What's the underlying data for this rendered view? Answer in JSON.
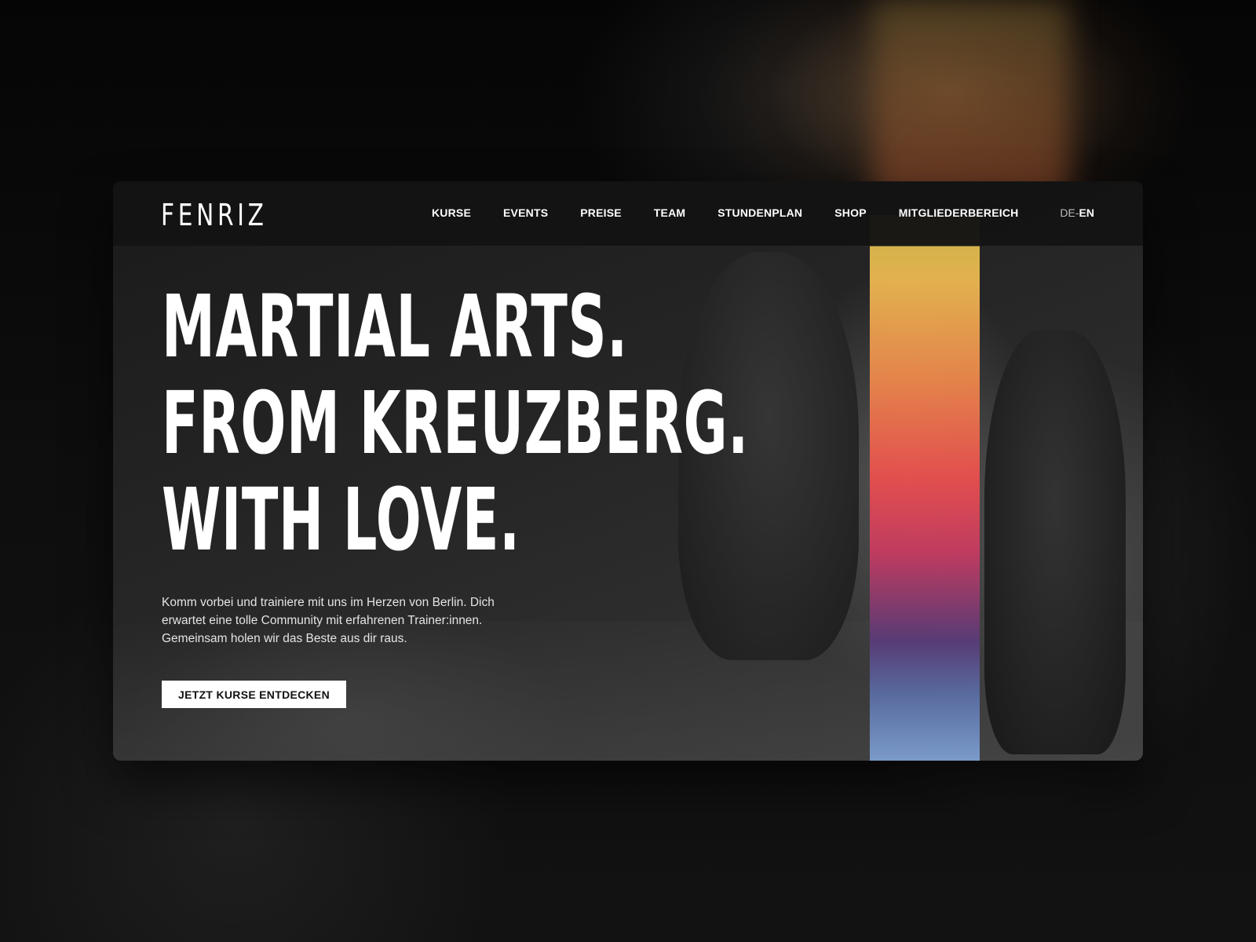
{
  "brand": {
    "logo_text": "FENRIZ"
  },
  "nav": {
    "items": [
      {
        "label": "KURSE"
      },
      {
        "label": "EVENTS"
      },
      {
        "label": "PREISE"
      },
      {
        "label": "TEAM"
      },
      {
        "label": "STUNDENPLAN"
      },
      {
        "label": "SHOP"
      },
      {
        "label": "MITGLIEDERBEREICH"
      }
    ],
    "language": {
      "de": "DE",
      "separator": "-",
      "en": "EN",
      "active": "EN"
    }
  },
  "hero": {
    "headline_lines": [
      "MARTIAL ARTS.",
      "FROM KREUZBERG.",
      "WITH LOVE."
    ],
    "intro": "Komm vorbei und trainiere mit uns im Herzen von Berlin. Dich erwartet eine tolle Community mit erfahrenen Trainer:innen. Gemeinsam holen wir das Beste aus dir raus.",
    "cta_label": "JETZT KURSE ENTDECKEN"
  },
  "colors": {
    "accent_gradient": [
      "#f2bd52",
      "#ef4f4e",
      "#5a3b7a",
      "#7fa2d6"
    ],
    "background": "#161616",
    "text": "#ffffff"
  }
}
